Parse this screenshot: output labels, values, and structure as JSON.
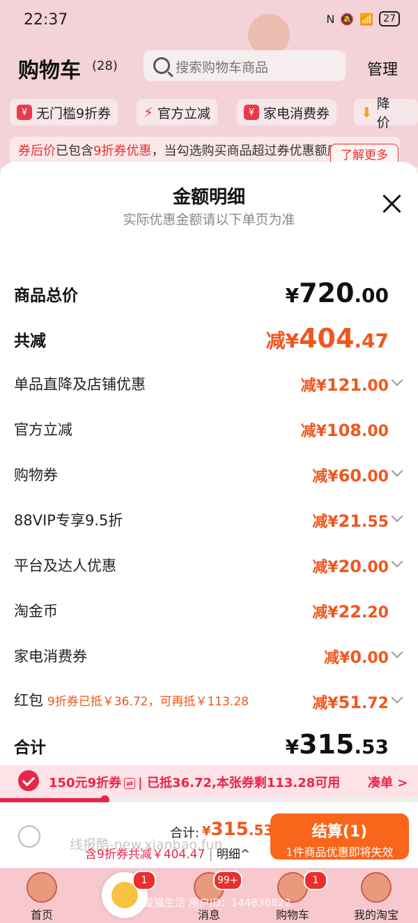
{
  "status_bar": {
    "time": "22:37",
    "battery": "27"
  },
  "header": {
    "title": "购物车",
    "count": "(28)",
    "search_placeholder": "搜索购物车商品",
    "manage_label": "管理"
  },
  "filter_chips": [
    {
      "label": "无门槛9折券",
      "icon": "coupon-icon"
    },
    {
      "label": "官方立减",
      "icon": "lightning-icon"
    },
    {
      "label": "家电消费券",
      "icon": "coupon-icon"
    },
    {
      "label": "降价",
      "icon": "price-down-icon"
    }
  ],
  "notice": {
    "prefix": "券后价",
    "mid": "已包含",
    "highlight": "9折券优惠",
    "rest": "，当勾选购买商品超过券优惠额度时，以后续金额为优惠价格可优先享受",
    "button": "了解更多"
  },
  "sheet": {
    "title": "金额明细",
    "subtitle": "实际优惠金额请以下单页为准",
    "rows": [
      {
        "label": "商品总价",
        "prefix": "¥",
        "int": "720",
        "dec": ".00"
      },
      {
        "label": "共减",
        "prefix": "减¥",
        "int": "404",
        "dec": ".47"
      },
      {
        "label": "单品直降及店铺优惠",
        "prefix": "减¥",
        "int": "121",
        "dec": ".00"
      },
      {
        "label": "官方立减",
        "prefix": "减¥",
        "int": "108",
        "dec": ".00"
      },
      {
        "label": "购物券",
        "prefix": "减¥",
        "int": "60",
        "dec": ".00"
      },
      {
        "label": "88VIP专享9.5折",
        "prefix": "减¥",
        "int": "21",
        "dec": ".55"
      },
      {
        "label": "平台及达人优惠",
        "prefix": "减¥",
        "int": "20",
        "dec": ".00"
      },
      {
        "label": "淘金币",
        "prefix": "减¥",
        "int": "22",
        "dec": ".20"
      },
      {
        "label": "家电消费券",
        "prefix": "减¥",
        "int": "0",
        "dec": ".00"
      },
      {
        "label": "红包",
        "note": "9折券已抵￥36.72，可再抵￥113.28",
        "prefix": "减¥",
        "int": "51",
        "dec": ".72"
      },
      {
        "label": "合计",
        "prefix": "¥",
        "int": "315",
        "dec": ".53"
      }
    ]
  },
  "coupon_bar": {
    "name": "150元9折券",
    "swap_icon": "⇌",
    "text": "已抵36.72,本张券剩113.28可用",
    "link": "凑单 >",
    "progress": 0.25
  },
  "checkout": {
    "watermark": "线报酷-new.xianbao.fun",
    "total_label": "合计:",
    "total_prefix": "¥",
    "total_int": "315",
    "total_dec": ".53",
    "saved_text": "含9折券共减￥404.47",
    "detail_link": "明细^",
    "pay_label": "结算(1)",
    "pay_sub": "1件商品优惠即将失效"
  },
  "tabbar": {
    "tabs": [
      "首页",
      "",
      "消息",
      "购物车",
      "我的淘宝"
    ],
    "badges": [
      "1",
      "99+",
      "1"
    ],
    "watermark": "爱猫生活  用户ID：144836822"
  },
  "colors": {
    "accent": "#f0571e",
    "red": "#e8254a",
    "pay_button": "#f9651a"
  }
}
